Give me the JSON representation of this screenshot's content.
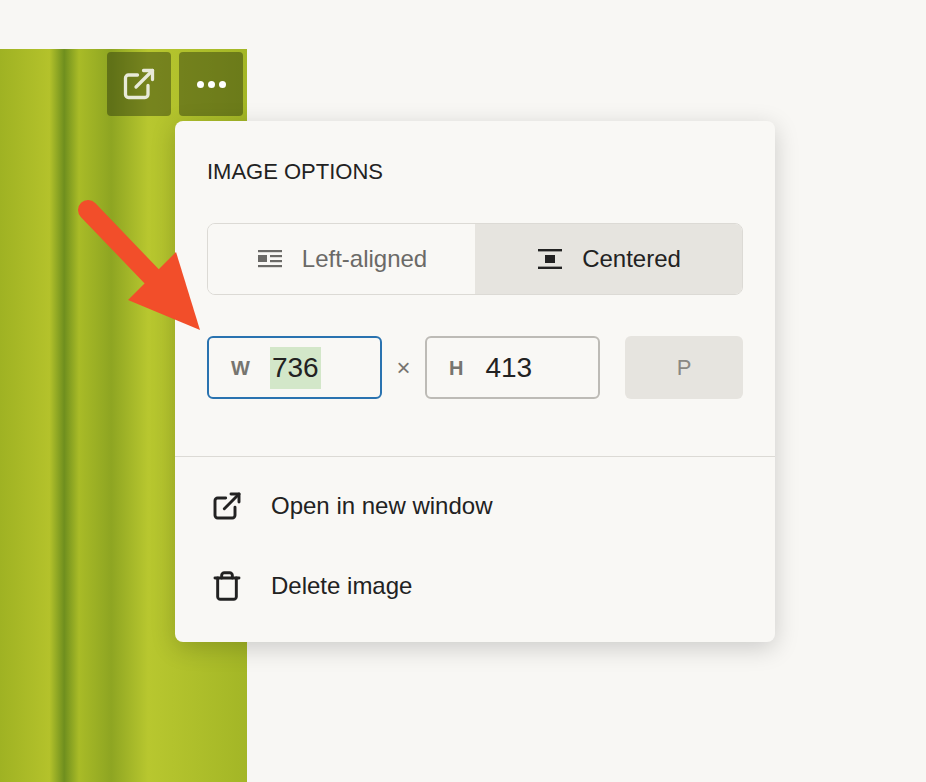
{
  "panel": {
    "title": "IMAGE OPTIONS",
    "alignment": [
      {
        "label": "Left-aligned",
        "kind": "left",
        "selected": false
      },
      {
        "label": "Centered",
        "kind": "center",
        "selected": true
      }
    ],
    "size": {
      "width": {
        "label": "W",
        "value": "736",
        "focused": true,
        "text_selected": true
      },
      "separator": "×",
      "height": {
        "label": "H",
        "value": "413",
        "focused": false,
        "text_selected": false
      },
      "button": {
        "label": "P"
      }
    },
    "actions": [
      {
        "label": "Open in new window",
        "kind": "open"
      },
      {
        "label": "Delete image",
        "kind": "delete"
      }
    ]
  }
}
